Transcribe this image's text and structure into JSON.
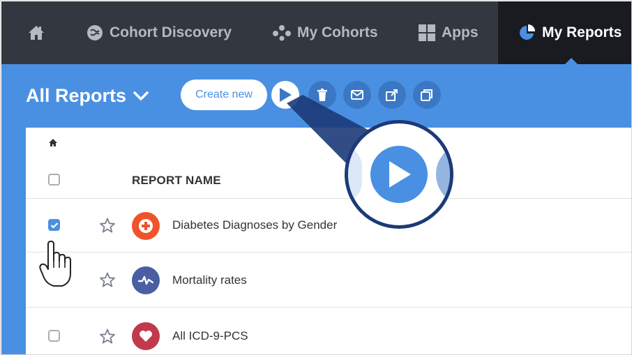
{
  "nav": {
    "home_icon": "home-icon",
    "items": [
      {
        "label": "Cohort Discovery",
        "icon": "brain-icon"
      },
      {
        "label": "My Cohorts",
        "icon": "cohorts-icon"
      },
      {
        "label": "Apps",
        "icon": "apps-grid-icon"
      },
      {
        "label": "My Reports",
        "icon": "pie-chart-icon",
        "active": true
      }
    ]
  },
  "toolbar": {
    "title": "All Reports",
    "create_label": "Create new",
    "buttons": [
      "run-icon",
      "trash-icon",
      "email-icon",
      "share-icon",
      "duplicate-icon"
    ]
  },
  "table": {
    "header": "REPORT NAME",
    "rows": [
      {
        "name": "Diabetes Diagnoses by Gender",
        "checked": true,
        "icon": "medical-cross-icon",
        "color": "#f0532c"
      },
      {
        "name": "Mortality rates",
        "checked": false,
        "icon": "pulse-icon",
        "color": "#4a5fa1"
      },
      {
        "name": "All ICD-9-PCS",
        "checked": false,
        "icon": "heart-icon",
        "color": "#c0394c"
      }
    ]
  },
  "colors": {
    "nav_bg": "#333740",
    "nav_active": "#191b21",
    "accent": "#4a90e2",
    "magnifier_border": "#1c3a78"
  }
}
